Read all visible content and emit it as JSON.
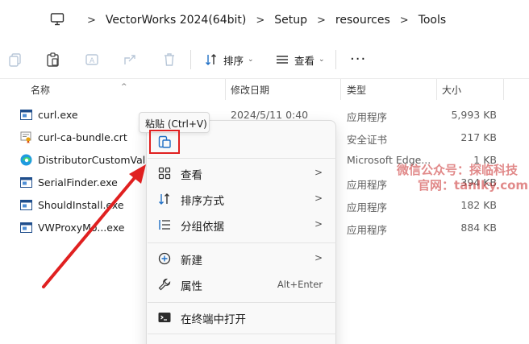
{
  "address": {
    "crumbs": [
      "VectorWorks 2024(64bit)",
      "Setup",
      "resources",
      "Tools"
    ]
  },
  "toolbar": {
    "sort_label": "排序",
    "view_label": "查看"
  },
  "columns": {
    "name": "名称",
    "date": "修改日期",
    "type": "类型",
    "size": "大小"
  },
  "files": [
    {
      "name": "curl.exe",
      "date": "2024/5/11 0:40",
      "type": "应用程序",
      "size": "5,993 KB",
      "icon": "exe-icon"
    },
    {
      "name": "curl-ca-bundle.crt",
      "date": "",
      "type": "安全证书",
      "size": "217 KB",
      "icon": "certificate-icon"
    },
    {
      "name": "DistributorCustomValue",
      "date": "",
      "type": "Microsoft Edge...",
      "size": "1 KB",
      "icon": "edge-icon"
    },
    {
      "name": "SerialFinder.exe",
      "date": "",
      "type": "应用程序",
      "size": "394 KB",
      "icon": "exe-icon"
    },
    {
      "name": "ShouldInstall.exe",
      "date": "",
      "type": "应用程序",
      "size": "182 KB",
      "icon": "exe-icon"
    },
    {
      "name": "VWProxyMo...exe",
      "date": "",
      "type": "应用程序",
      "size": "884 KB",
      "icon": "exe-icon"
    }
  ],
  "tooltip": "粘贴 (Ctrl+V)",
  "context_menu": {
    "items": [
      {
        "label": "查看",
        "icon": "grid-icon",
        "submenu": true
      },
      {
        "label": "排序方式",
        "icon": "sort-icon",
        "submenu": true
      },
      {
        "label": "分组依据",
        "icon": "group-icon",
        "submenu": true
      },
      {
        "label": "新建",
        "icon": "plus-circle-icon",
        "submenu": true
      },
      {
        "label": "属性",
        "icon": "wrench-icon",
        "shortcut": "Alt+Enter"
      },
      {
        "label": "在终端中打开",
        "icon": "terminal-icon"
      }
    ]
  },
  "watermark": {
    "line1": "微信公众号：探临科技",
    "line2": "官网：tanlky.com"
  },
  "colors": {
    "highlight_red": "#e02020",
    "accent_blue": "#1f6fc5"
  }
}
